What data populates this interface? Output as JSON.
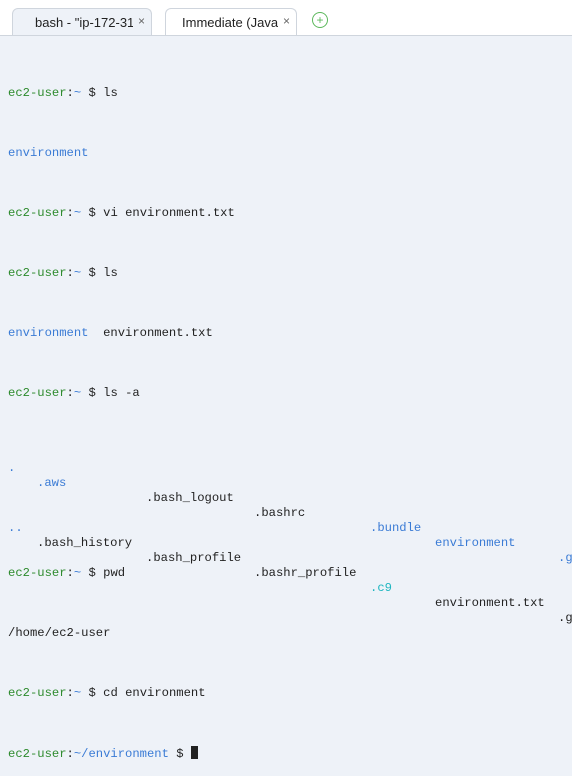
{
  "tabs": [
    {
      "label": "bash - \"ip-172-31",
      "close": "×",
      "active": true
    },
    {
      "label": "Immediate (Javas",
      "close": "×",
      "active": false
    }
  ],
  "add_tab": "+",
  "prompt": {
    "user": "ec2-user",
    "colon": ":",
    "home": "~",
    "dollar": " $ "
  },
  "lines": {
    "l1_cmd": "ls",
    "l2_out": "environment",
    "l3_cmd": "vi environment.txt",
    "l4_cmd": "ls",
    "l5_out_dir": "environment",
    "l5_out_file": "environment.txt",
    "l6_cmd": "ls -a",
    "l7": [
      ".",
      ".aws",
      ".bash_logout",
      ".bashrc",
      ".bundle",
      "environment",
      ".g"
    ],
    "l8": [
      "..",
      ".bash_history",
      ".bash_profile",
      ".bashr_profile",
      ".c9",
      "environment.txt",
      ".g"
    ],
    "l9_cmd": "pwd",
    "l10_out": "/home/ec2-user",
    "l11_cmd": "cd environment",
    "l12_path": "~/environment"
  },
  "colors": {
    "user": "#2e8b2e",
    "directory": "#3a7bd5",
    "c9": "#1fb6c0",
    "add_tab": "#5cb85c"
  }
}
